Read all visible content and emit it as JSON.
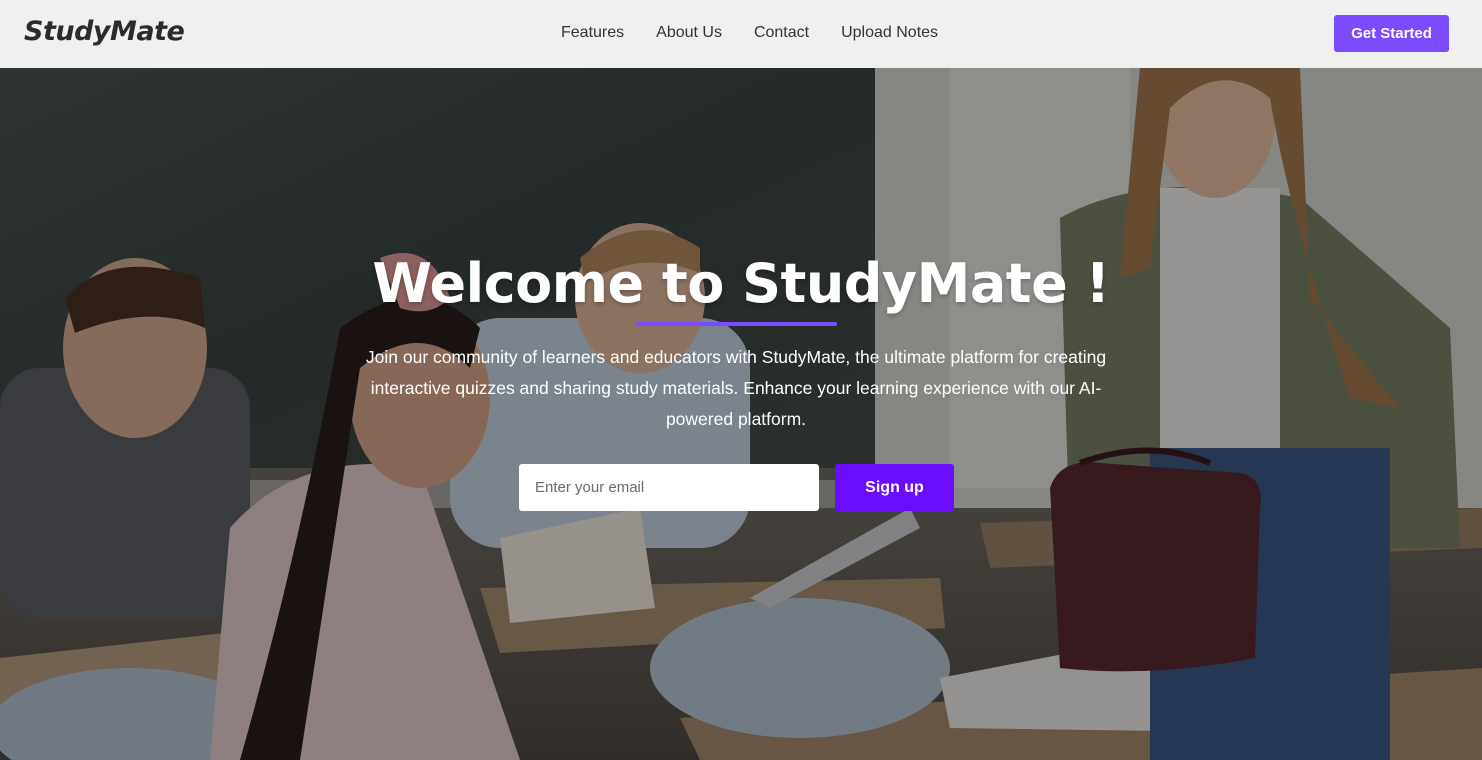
{
  "brand": {
    "name": "StudyMate"
  },
  "nav": {
    "links": [
      {
        "label": "Features"
      },
      {
        "label": "About Us"
      },
      {
        "label": "Contact"
      },
      {
        "label": "Upload Notes"
      }
    ],
    "cta_label": "Get Started"
  },
  "hero": {
    "title": "Welcome to StudyMate !",
    "description": "Join our community of learners and educators with StudyMate, the ultimate platform for creating interactive quizzes and sharing study materials. Enhance your learning experience with our AI-powered platform.",
    "email_placeholder": "Enter your email",
    "signup_label": "Sign up",
    "background_image": "classroom-students-photo"
  },
  "colors": {
    "accent": "#7b4cff",
    "signup_button": "#6a0dff",
    "nav_bg": "#f0f0f0"
  }
}
